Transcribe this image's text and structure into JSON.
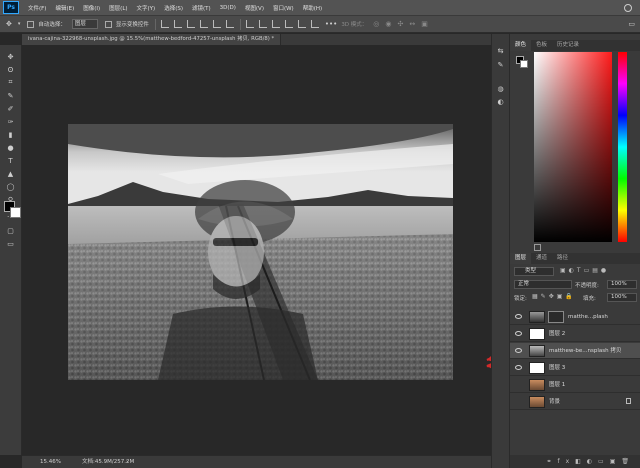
{
  "menubar": {
    "logo": "Ps",
    "items": [
      "文件(F)",
      "编辑(E)",
      "图像(I)",
      "图层(L)",
      "文字(Y)",
      "选择(S)",
      "滤镜(T)",
      "3D(D)",
      "视图(V)",
      "窗口(W)",
      "帮助(H)"
    ]
  },
  "options": {
    "auto_select": "自动选择：",
    "auto_select_value": "图层",
    "show_transform": "显示变换控件",
    "mode_3d": "3D 模式："
  },
  "document": {
    "tab_title": "ivana-cajina-322968-unsplash.jpg @ 15.5%(matthew-bedford-47257-unsplash 拷贝, RGB/8) *"
  },
  "status": {
    "zoom": "15.46%",
    "doc_info": "文档:45.9M/257.2M"
  },
  "color_panel": {
    "tabs": [
      "颜色",
      "色板",
      "历史记录"
    ]
  },
  "layers_panel": {
    "tabs": [
      "图层",
      "通道",
      "路径"
    ],
    "filter_kind": "类型",
    "blend_mode": "正常",
    "opacity_label": "不透明度:",
    "opacity_value": "100%",
    "lock_label": "锁定:",
    "fill_label": "填充:",
    "fill_value": "100%",
    "layers": [
      {
        "name": "matthe...plash",
        "visible": true,
        "selected": false
      },
      {
        "name": "图层 2",
        "visible": true,
        "selected": false
      },
      {
        "name": "matthew-be...nsplash 拷贝",
        "visible": true,
        "selected": true
      },
      {
        "name": "图层 3",
        "visible": true,
        "selected": false
      },
      {
        "name": "图层 1",
        "visible": false,
        "selected": false
      },
      {
        "name": "背景",
        "visible": false,
        "selected": false
      }
    ]
  },
  "colors": {
    "annotation_arrow": "#d22a2a",
    "panel_bg": "#3a3a3a"
  }
}
